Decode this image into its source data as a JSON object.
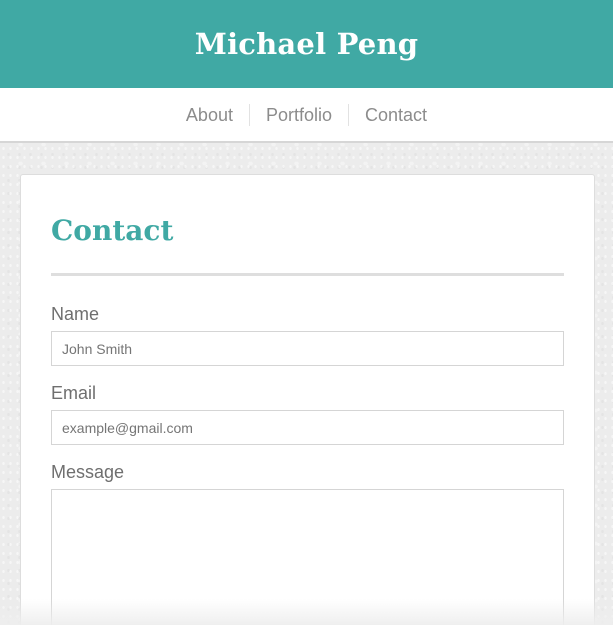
{
  "header": {
    "title": "Michael Peng"
  },
  "nav": {
    "items": [
      {
        "label": "About"
      },
      {
        "label": "Portfolio"
      },
      {
        "label": "Contact"
      }
    ]
  },
  "contact_form": {
    "title": "Contact",
    "name": {
      "label": "Name",
      "value": "",
      "placeholder": "John Smith"
    },
    "email": {
      "label": "Email",
      "value": "",
      "placeholder": "example@gmail.com"
    },
    "message": {
      "label": "Message",
      "value": "",
      "placeholder": ""
    }
  },
  "colors": {
    "accent": "#40a9a4",
    "nav_text": "#8c8c8c",
    "label_text": "#6f6f6f",
    "page_background": "#ececec"
  }
}
